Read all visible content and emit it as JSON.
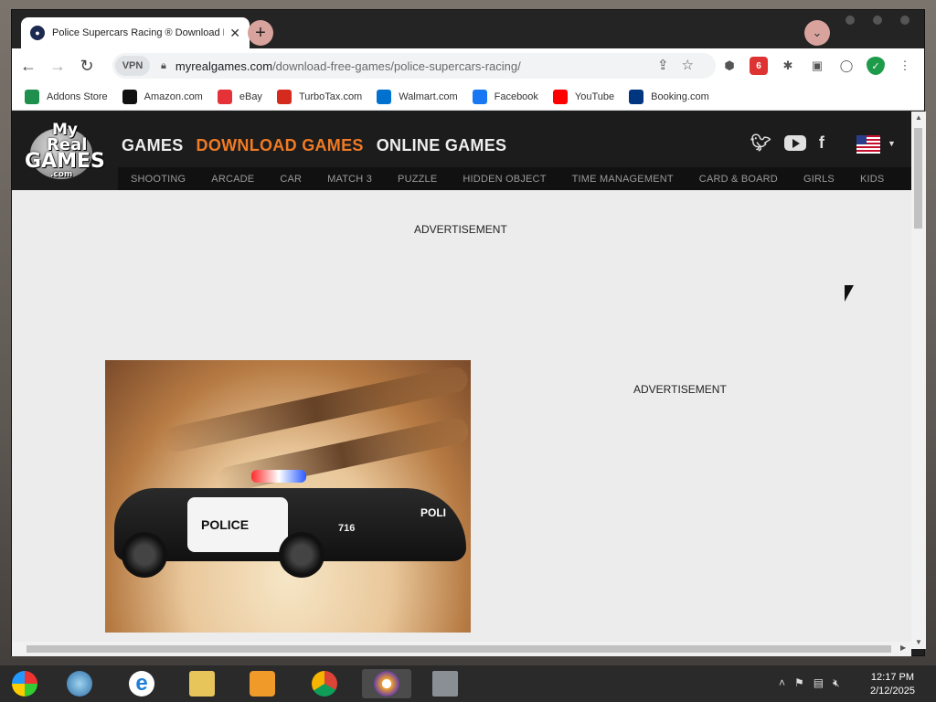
{
  "browser": {
    "tab_title": "Police Supercars Racing ® Download Fre",
    "url_host": "myrealgames.com",
    "url_path": "/download-free-games/police-supercars-racing/",
    "vpn_label": "VPN"
  },
  "bookmarks": [
    {
      "label": "Addons Store",
      "icon": "addons-store-icon",
      "color": "#1f8f4e"
    },
    {
      "label": "Amazon.com",
      "icon": "amazon-icon",
      "color": "#111111"
    },
    {
      "label": "eBay",
      "icon": "ebay-icon",
      "color": "#e53238"
    },
    {
      "label": "TurboTax.com",
      "icon": "turbotax-icon",
      "color": "#d52b1e"
    },
    {
      "label": "Walmart.com",
      "icon": "walmart-icon",
      "color": "#0071ce"
    },
    {
      "label": "Facebook",
      "icon": "facebook-icon",
      "color": "#1877f2"
    },
    {
      "label": "YouTube",
      "icon": "youtube-icon",
      "color": "#ff0000"
    },
    {
      "label": "Booking.com",
      "icon": "booking-icon",
      "color": "#003580"
    }
  ],
  "site": {
    "logo": {
      "line1": "My",
      "line2": "Real",
      "line3": "GAMES",
      "line4": ".com"
    },
    "primary_nav": [
      "GAMES",
      "DOWNLOAD GAMES",
      "ONLINE GAMES"
    ],
    "active_nav": "DOWNLOAD GAMES",
    "accent": "#f07a25",
    "sub_nav": [
      "SHOOTING",
      "ARCADE",
      "CAR",
      "MATCH 3",
      "PUZZLE",
      "HIDDEN OBJECT",
      "TIME MANAGEMENT",
      "CARD & BOARD",
      "GIRLS",
      "KIDS"
    ],
    "ad_label_top": "ADVERTISEMENT",
    "ad_label_side": "ADVERTISEMENT",
    "hero": {
      "police_text": "POLICE",
      "car_number": "716",
      "side_text": "POLI"
    }
  },
  "taskbar": {
    "time": "12:17 PM",
    "date": "2/12/2025"
  }
}
